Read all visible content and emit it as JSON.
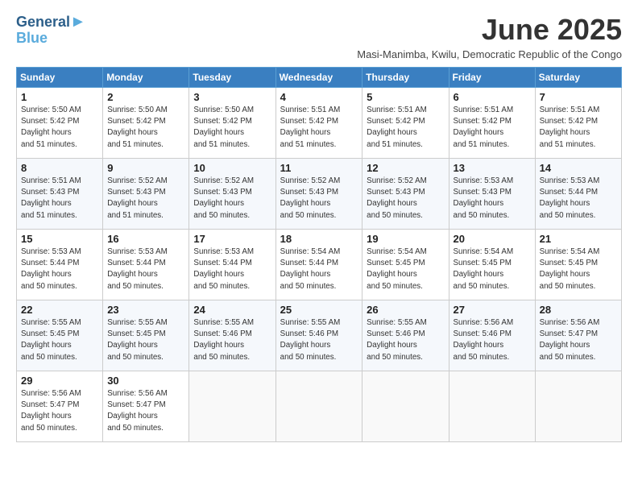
{
  "logo": {
    "line1": "General",
    "line2": "Blue"
  },
  "title": "June 2025",
  "subtitle": "Masi-Manimba, Kwilu, Democratic Republic of the Congo",
  "days_of_week": [
    "Sunday",
    "Monday",
    "Tuesday",
    "Wednesday",
    "Thursday",
    "Friday",
    "Saturday"
  ],
  "weeks": [
    [
      {
        "day": 1,
        "sunrise": "5:50 AM",
        "sunset": "5:42 PM",
        "daylight": "11 hours and 51 minutes."
      },
      {
        "day": 2,
        "sunrise": "5:50 AM",
        "sunset": "5:42 PM",
        "daylight": "11 hours and 51 minutes."
      },
      {
        "day": 3,
        "sunrise": "5:50 AM",
        "sunset": "5:42 PM",
        "daylight": "11 hours and 51 minutes."
      },
      {
        "day": 4,
        "sunrise": "5:51 AM",
        "sunset": "5:42 PM",
        "daylight": "11 hours and 51 minutes."
      },
      {
        "day": 5,
        "sunrise": "5:51 AM",
        "sunset": "5:42 PM",
        "daylight": "11 hours and 51 minutes."
      },
      {
        "day": 6,
        "sunrise": "5:51 AM",
        "sunset": "5:42 PM",
        "daylight": "11 hours and 51 minutes."
      },
      {
        "day": 7,
        "sunrise": "5:51 AM",
        "sunset": "5:42 PM",
        "daylight": "11 hours and 51 minutes."
      }
    ],
    [
      {
        "day": 8,
        "sunrise": "5:51 AM",
        "sunset": "5:43 PM",
        "daylight": "11 hours and 51 minutes."
      },
      {
        "day": 9,
        "sunrise": "5:52 AM",
        "sunset": "5:43 PM",
        "daylight": "11 hours and 51 minutes."
      },
      {
        "day": 10,
        "sunrise": "5:52 AM",
        "sunset": "5:43 PM",
        "daylight": "11 hours and 50 minutes."
      },
      {
        "day": 11,
        "sunrise": "5:52 AM",
        "sunset": "5:43 PM",
        "daylight": "11 hours and 50 minutes."
      },
      {
        "day": 12,
        "sunrise": "5:52 AM",
        "sunset": "5:43 PM",
        "daylight": "11 hours and 50 minutes."
      },
      {
        "day": 13,
        "sunrise": "5:53 AM",
        "sunset": "5:43 PM",
        "daylight": "11 hours and 50 minutes."
      },
      {
        "day": 14,
        "sunrise": "5:53 AM",
        "sunset": "5:44 PM",
        "daylight": "11 hours and 50 minutes."
      }
    ],
    [
      {
        "day": 15,
        "sunrise": "5:53 AM",
        "sunset": "5:44 PM",
        "daylight": "11 hours and 50 minutes."
      },
      {
        "day": 16,
        "sunrise": "5:53 AM",
        "sunset": "5:44 PM",
        "daylight": "11 hours and 50 minutes."
      },
      {
        "day": 17,
        "sunrise": "5:53 AM",
        "sunset": "5:44 PM",
        "daylight": "11 hours and 50 minutes."
      },
      {
        "day": 18,
        "sunrise": "5:54 AM",
        "sunset": "5:44 PM",
        "daylight": "11 hours and 50 minutes."
      },
      {
        "day": 19,
        "sunrise": "5:54 AM",
        "sunset": "5:45 PM",
        "daylight": "11 hours and 50 minutes."
      },
      {
        "day": 20,
        "sunrise": "5:54 AM",
        "sunset": "5:45 PM",
        "daylight": "11 hours and 50 minutes."
      },
      {
        "day": 21,
        "sunrise": "5:54 AM",
        "sunset": "5:45 PM",
        "daylight": "11 hours and 50 minutes."
      }
    ],
    [
      {
        "day": 22,
        "sunrise": "5:55 AM",
        "sunset": "5:45 PM",
        "daylight": "11 hours and 50 minutes."
      },
      {
        "day": 23,
        "sunrise": "5:55 AM",
        "sunset": "5:45 PM",
        "daylight": "11 hours and 50 minutes."
      },
      {
        "day": 24,
        "sunrise": "5:55 AM",
        "sunset": "5:46 PM",
        "daylight": "11 hours and 50 minutes."
      },
      {
        "day": 25,
        "sunrise": "5:55 AM",
        "sunset": "5:46 PM",
        "daylight": "11 hours and 50 minutes."
      },
      {
        "day": 26,
        "sunrise": "5:55 AM",
        "sunset": "5:46 PM",
        "daylight": "11 hours and 50 minutes."
      },
      {
        "day": 27,
        "sunrise": "5:56 AM",
        "sunset": "5:46 PM",
        "daylight": "11 hours and 50 minutes."
      },
      {
        "day": 28,
        "sunrise": "5:56 AM",
        "sunset": "5:47 PM",
        "daylight": "11 hours and 50 minutes."
      }
    ],
    [
      {
        "day": 29,
        "sunrise": "5:56 AM",
        "sunset": "5:47 PM",
        "daylight": "11 hours and 50 minutes."
      },
      {
        "day": 30,
        "sunrise": "5:56 AM",
        "sunset": "5:47 PM",
        "daylight": "11 hours and 50 minutes."
      },
      null,
      null,
      null,
      null,
      null
    ]
  ]
}
